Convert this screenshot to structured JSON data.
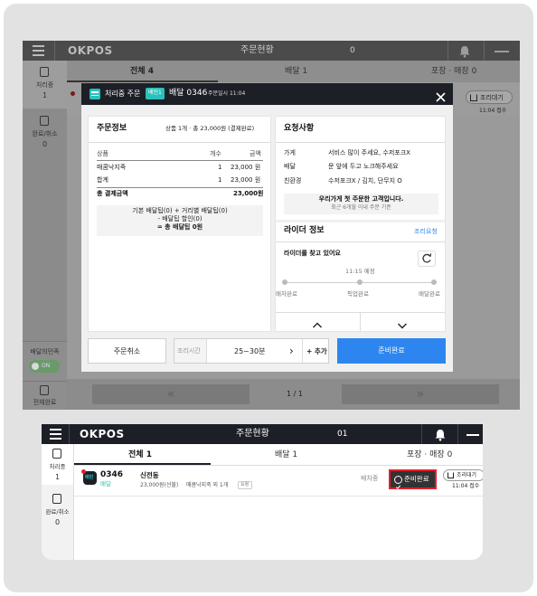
{
  "app": {
    "logo": "OKPOS",
    "title": "주문현황",
    "order_count_top": "0",
    "order_count_bottom": "01"
  },
  "sidebar": {
    "processing_label": "처리중",
    "processing_count": "1",
    "done_label": "완료/취소",
    "done_count": "0",
    "delivery_agency_label": "배달의민족",
    "delivery_agency_toggle": "ON",
    "delivery_done_label": "전체완료"
  },
  "tabs": {
    "all_top": "전체 4",
    "all_bottom": "전체 1",
    "delivery": "배달 1",
    "pickup": "포장 · 매장 0"
  },
  "background_order": {
    "status": "조리대기",
    "time": "11:04 접수"
  },
  "modal": {
    "status_label": "처리중 주문",
    "badge": "배민1",
    "order_title": "배달 0346",
    "order_time": "주문일시 11:04",
    "order_info": {
      "title": "주문정보",
      "summary": "상품 1개 · 총 23,000원 (결제완료)",
      "col_product": "상품",
      "col_qty": "개수",
      "col_amount": "금액",
      "rows": [
        {
          "name": "매콤낙지죽",
          "qty": "1",
          "amount": "23,000 원"
        },
        {
          "name": "합계",
          "qty": "1",
          "amount": "23,000 원"
        }
      ],
      "total_label": "총 결제금액",
      "total_value": "23,000원",
      "tip_line1": "기본 배달팁(0) + 거리별 배달팁(0)",
      "tip_line2": "- 배달팁 할인(0)",
      "tip_line3": "= 총 배달팁 0원"
    },
    "requests": {
      "title": "요청사항",
      "rows": [
        {
          "label": "가게",
          "value": "서비스 많이 주세요, 수저포크X"
        },
        {
          "label": "배달",
          "value": "문 앞에 두고 노크해주세요"
        },
        {
          "label": "친환경",
          "value": "수저포크X / 김치, 단무지 O"
        }
      ],
      "customer_title": "우리가게 첫 주문한 고객입니다.",
      "customer_sub": "최근 6개월 이내 주문 기준"
    },
    "rider": {
      "title": "라이더 정보",
      "link": "조리요청",
      "status": "라이더를 찾고 있어요",
      "eta": "11:15 예정",
      "steps": [
        "배차완료",
        "픽업완료",
        "배달완료"
      ]
    },
    "footer": {
      "cancel": "주문취소",
      "cook_time_label": "조리시간",
      "cook_time_value": "25~30분",
      "next_icon": "›",
      "add": "+ 추가",
      "ready": "준비완료"
    }
  },
  "pagination": {
    "prev": "«",
    "page": "1 / 1",
    "next": "»"
  },
  "order_row": {
    "logo_text": "배민",
    "number": "0346",
    "type": "배달",
    "customer": "신전동",
    "price": "23,000원(선불)",
    "items": "매콤낙지죽 외 1개",
    "tag": "요청",
    "state": "배차중",
    "ready_button": "준비완료",
    "status": "조리대기",
    "time": "11:04 접수"
  },
  "colors": {
    "accent_blue": "#2d86f0",
    "badge_teal": "#2ac1bc",
    "highlight_red": "#e0202a",
    "topbar": "#1d1f27"
  }
}
